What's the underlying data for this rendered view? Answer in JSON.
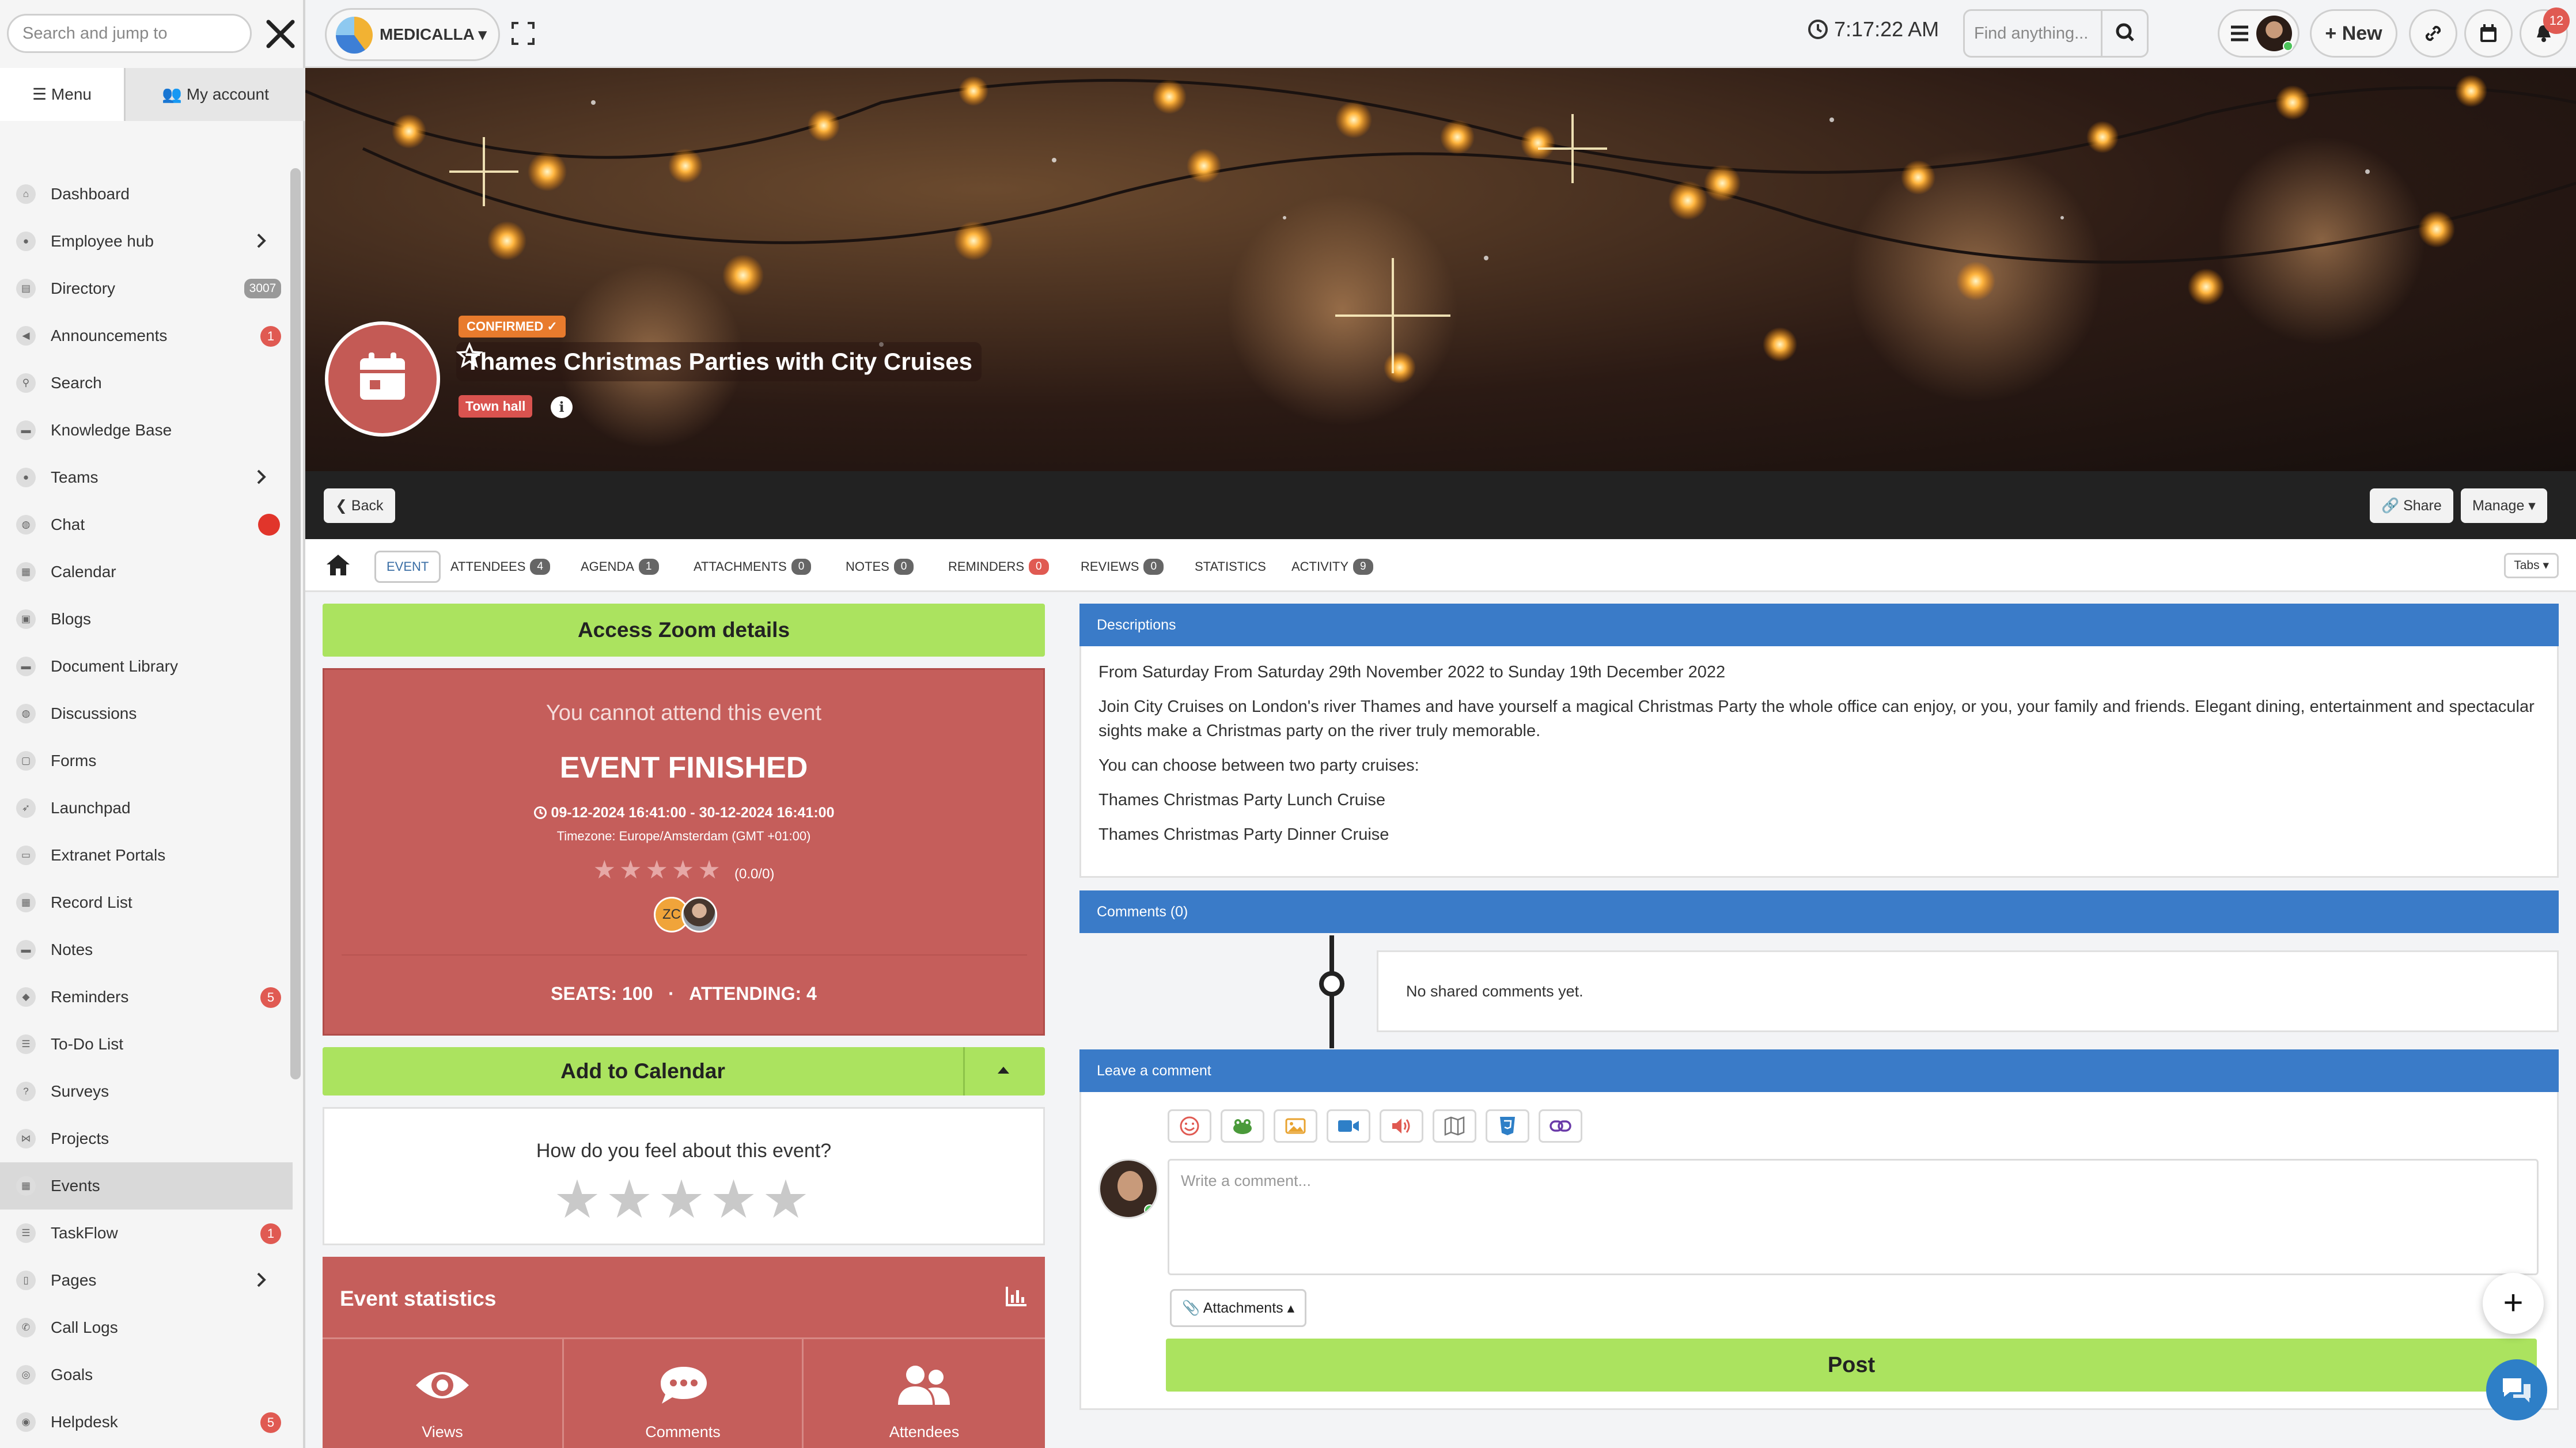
{
  "sidebar": {
    "search_placeholder": "Search and jump to",
    "tabs": {
      "menu": "Menu",
      "account": "My account"
    },
    "items": [
      {
        "label": "Dashboard"
      },
      {
        "label": "Employee hub"
      },
      {
        "label": "Directory",
        "badge": "3007"
      },
      {
        "label": "Announcements",
        "badge": "1"
      },
      {
        "label": "Search"
      },
      {
        "label": "Knowledge Base"
      },
      {
        "label": "Teams"
      },
      {
        "label": "Chat"
      },
      {
        "label": "Calendar"
      },
      {
        "label": "Blogs"
      },
      {
        "label": "Document Library"
      },
      {
        "label": "Discussions"
      },
      {
        "label": "Forms"
      },
      {
        "label": "Launchpad"
      },
      {
        "label": "Extranet Portals"
      },
      {
        "label": "Record List"
      },
      {
        "label": "Notes"
      },
      {
        "label": "Reminders",
        "badge": "5"
      },
      {
        "label": "To-Do List"
      },
      {
        "label": "Surveys"
      },
      {
        "label": "Projects"
      },
      {
        "label": "Events"
      },
      {
        "label": "TaskFlow",
        "badge": "1"
      },
      {
        "label": "Pages"
      },
      {
        "label": "Call Logs"
      },
      {
        "label": "Goals"
      },
      {
        "label": "Helpdesk",
        "badge": "5"
      }
    ]
  },
  "topbar": {
    "brand": "MEDICALLA",
    "time": "7:17:22 AM",
    "find_placeholder": "Find anything...",
    "new_label": "New",
    "notifications_count": "12"
  },
  "hero": {
    "status": "CONFIRMED",
    "title": "Thames Christmas Parties with City Cruises",
    "category": "Town hall",
    "info": "i"
  },
  "actions": {
    "back": "Back",
    "share": "Share",
    "manage": "Manage"
  },
  "tabs": {
    "event": "EVENT",
    "attendees": "ATTENDEES",
    "attendees_count": "4",
    "agenda": "AGENDA",
    "agenda_count": "1",
    "attachments": "ATTACHMENTS",
    "attachments_count": "0",
    "notes": "NOTES",
    "notes_count": "0",
    "reminders": "REMINDERS",
    "reminders_count": "0",
    "reviews": "REVIEWS",
    "reviews_count": "0",
    "statistics": "STATISTICS",
    "activity": "ACTIVITY",
    "activity_count": "9",
    "tabs_btn": "Tabs"
  },
  "event_panel": {
    "zoom": "Access Zoom details",
    "cannot_attend": "You cannot attend this event",
    "finished": "EVENT FINISHED",
    "dates": "09-12-2024 16:41:00 - 30-12-2024 16:41:00",
    "timezone": "Timezone: Europe/Amsterdam (GMT +01:00)",
    "rating_stars": "★★★★★",
    "rating_text": "(0.0/0)",
    "attendee_initials": "ZC",
    "seats": "SEATS: 100",
    "separator": "·",
    "attending": "ATTENDING: 4",
    "add_to_calendar": "Add to Calendar",
    "feel_question": "How do you feel about this event?",
    "feel_stars": "★★★★★",
    "stats_title": "Event statistics",
    "stats": {
      "views": "Views",
      "comments": "Comments",
      "attendees": "Attendees"
    }
  },
  "descriptions": {
    "heading": "Descriptions",
    "paragraphs": [
      "From Saturday From Saturday 29th November 2022 to Sunday 19th December 2022",
      "Join City Cruises on London's river Thames and have yourself a magical Christmas Party the whole office can enjoy, or you, your family and friends. Elegant dining, entertainment and spectacular sights make a Christmas party on the river truly memorable.",
      "You can choose between two party cruises:",
      "Thames Christmas Party Lunch Cruise",
      "Thames Christmas Party Dinner Cruise"
    ]
  },
  "comments": {
    "heading": "Comments (0)",
    "empty": "No shared comments yet.",
    "leave_heading": "Leave a comment",
    "placeholder": "Write a comment...",
    "attachments": "Attachments",
    "post": "Post"
  },
  "colors": {
    "accent_green": "#abe35f",
    "panel_red": "#c55e5b",
    "header_blue": "#3a7bc8",
    "badge_red": "#e05a52",
    "status_orange": "#e87b2d"
  }
}
